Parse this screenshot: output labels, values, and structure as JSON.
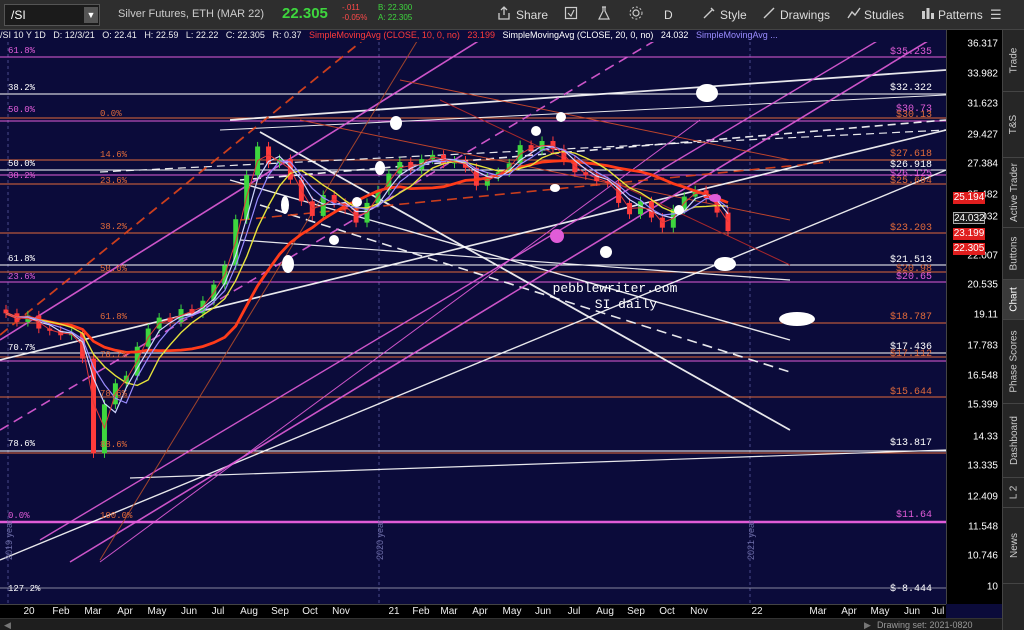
{
  "toolbar": {
    "symbol": "/SI",
    "description": "Silver Futures, ETH (MAR 22)",
    "last_price": "22.305",
    "net_change": "-.011",
    "pct_change": "-0.05%",
    "bid": "B: 22.300",
    "ask": "A: 22.305",
    "share_label": "Share",
    "period_label": "D",
    "style_label": "Style",
    "drawings_label": "Drawings",
    "studies_label": "Studies",
    "patterns_label": "Patterns",
    "icons": [
      "share-icon",
      "favorite-icon",
      "flask-icon",
      "style-icon",
      "drawings-icon",
      "studies-icon",
      "patterns-icon"
    ]
  },
  "infobar": {
    "symbol_period": "/SI 10 Y 1D",
    "date": "D: 12/3/21",
    "open": "O: 22.41",
    "high": "H: 22.59",
    "low": "L: 22.22",
    "close": "C: 22.305",
    "range": "R: 0.37",
    "sma10_label": "SimpleMovingAvg (CLOSE, 10, 0, no)",
    "sma10_value": "23.199",
    "sma20_label": "SimpleMovingAvg (CLOSE, 20, 0, no)",
    "sma20_value": "24.032",
    "sma3_label": "SimpleMovingAvg ..."
  },
  "price_axis": {
    "ticks": [
      "36.317",
      "33.982",
      "31.623",
      "29.427",
      "27.384",
      "25.482",
      "24.032",
      "22.007",
      "20.535",
      "19.11",
      "17.783",
      "16.548",
      "15.399",
      "14.33",
      "13.335",
      "12.409",
      "11.548",
      "10.746",
      "10"
    ],
    "tags": [
      {
        "value": "25.194",
        "color": "#e01e1e"
      },
      {
        "value": "24.032",
        "color": "#1b1b1b"
      },
      {
        "value": "23.199",
        "color": "#e01e1e"
      },
      {
        "value": "22.305",
        "color": "#e01e1e"
      }
    ]
  },
  "date_axis": {
    "labels": [
      "20",
      "Feb",
      "Mar",
      "Apr",
      "May",
      "Jun",
      "Jul",
      "Aug",
      "Sep",
      "Oct",
      "Nov",
      "21",
      "Feb",
      "Mar",
      "Apr",
      "May",
      "Jun",
      "Jul",
      "Aug",
      "Sep",
      "Oct",
      "Nov",
      "22",
      "Mar",
      "Apr",
      "May",
      "Jun",
      "Jul"
    ]
  },
  "chart_annotations": {
    "fib_left": [
      "61.8%",
      "38.2%",
      "50.0%",
      "50.0%",
      "38.2%",
      "61.8%",
      "23.6%",
      "70.7%",
      "78.6%",
      "0.0%",
      "127.2%"
    ],
    "fib_center": [
      "0.0%",
      "14.6%",
      "23.6%",
      "38.2%",
      "50.0%",
      "61.8%",
      "70.7%",
      "78.6%",
      "88.6%",
      "100.0%"
    ],
    "fib_right": [
      "$35.235",
      "$32.322",
      "$30.73",
      "$30.13",
      "$27.618",
      "$26.918",
      "$26.125",
      "$25.694",
      "$23.203",
      "$21.513",
      "$20.98",
      "$20.65",
      "$18.787",
      "$17.436",
      "$17.112",
      "$15.644",
      "$13.817",
      "$11.64",
      "$-8.444"
    ],
    "watermark_1": "pebblewriter.com",
    "watermark_2": "SI daily",
    "year_markers": [
      "2019 year",
      "2020 year",
      "2021 year"
    ]
  },
  "side_tabs": [
    "Trade",
    "T&S",
    "Active Trader",
    "Buttons",
    "Chart",
    "Phase Scores",
    "Dashboard",
    "L 2",
    "News"
  ],
  "bottom_bar": {
    "drawing_set": "Drawing set: 2021-0820"
  },
  "chart_data": {
    "type": "candlestick",
    "price_range": [
      8.44,
      36.5
    ],
    "scale": "log",
    "series": [
      {
        "name": "SimpleMovingAvg (CLOSE, 10, 0, no)",
        "color": "#e03a3a"
      },
      {
        "name": "SimpleMovingAvg (CLOSE, 20, 0, no)",
        "color": "#cfd6ff"
      },
      {
        "name": "SimpleMovingAvg ...",
        "color": "#9a8cff"
      }
    ],
    "close_series": [
      18.0,
      17.6,
      17.9,
      17.3,
      17.2,
      17.0,
      17.1,
      16.0,
      12.5,
      14.2,
      15.0,
      15.3,
      16.5,
      17.3,
      17.8,
      17.6,
      18.2,
      18.0,
      18.6,
      19.4,
      20.4,
      23.0,
      25.8,
      27.8,
      26.6,
      26.9,
      25.5,
      24.1,
      23.2,
      24.5,
      24.0,
      23.6,
      22.8,
      24.0,
      24.8,
      25.9,
      26.7,
      26.2,
      26.9,
      27.2,
      26.6,
      26.8,
      26.3,
      25.1,
      25.7,
      26.0,
      26.6,
      27.9,
      27.5,
      28.2,
      27.6,
      26.8,
      26.0,
      25.8,
      25.4,
      25.3,
      24.0,
      23.3,
      24.1,
      23.1,
      22.5,
      23.6,
      24.4,
      24.8,
      24.3,
      23.4,
      22.3
    ]
  }
}
